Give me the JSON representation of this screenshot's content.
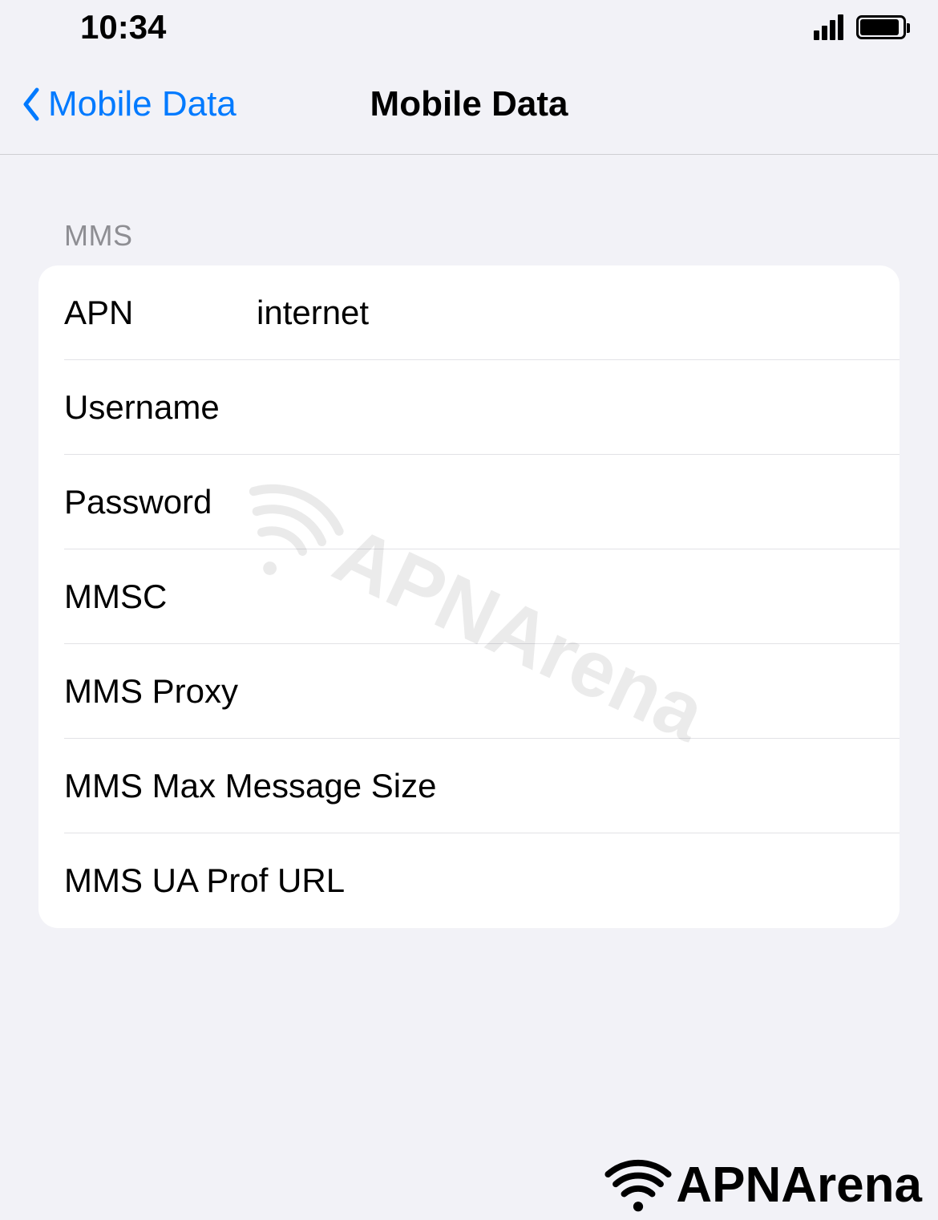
{
  "status_bar": {
    "time": "10:34"
  },
  "nav": {
    "back_label": "Mobile Data",
    "title": "Mobile Data"
  },
  "section": {
    "header": "MMS",
    "fields": [
      {
        "label": "APN",
        "value": "internet",
        "has_input": true
      },
      {
        "label": "Username",
        "value": "",
        "has_input": true
      },
      {
        "label": "Password",
        "value": "",
        "has_input": true
      },
      {
        "label": "MMSC",
        "value": "",
        "has_input": true
      },
      {
        "label": "MMS Proxy",
        "value": "",
        "has_input": true
      },
      {
        "label": "MMS Max Message Size",
        "value": "",
        "has_input": false
      },
      {
        "label": "MMS UA Prof URL",
        "value": "",
        "has_input": false
      }
    ]
  },
  "watermark": "APNArena",
  "footer_logo": "APNArena"
}
